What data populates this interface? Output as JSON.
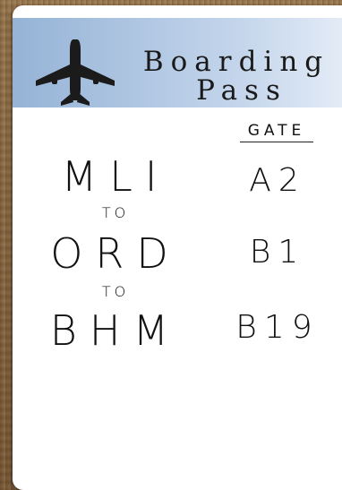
{
  "header": {
    "title_line1": "Boarding",
    "title_line2": "Pass"
  },
  "icons": {
    "plane": "airplane-icon"
  },
  "gate_header": "GATE",
  "route": [
    {
      "airport": "MLI",
      "gate": "A2"
    },
    {
      "separator": "TO"
    },
    {
      "airport": "ORD",
      "gate": "B1"
    },
    {
      "separator": "TO"
    },
    {
      "airport": "BHM",
      "gate": "B19"
    }
  ],
  "colors": {
    "header_gradient_start": "#95b3d6",
    "header_gradient_end": "#e3ebf6",
    "text": "#111111",
    "card": "#ffffff"
  }
}
